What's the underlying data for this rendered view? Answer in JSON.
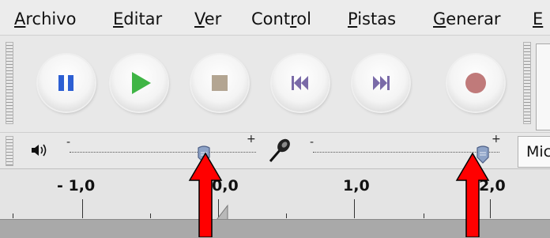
{
  "menu": {
    "items": [
      {
        "accel": "A",
        "rest": "rchivo"
      },
      {
        "accel": "E",
        "rest": "ditar"
      },
      {
        "accel": "V",
        "rest": "er"
      },
      {
        "pre": "Cont",
        "accel": "r",
        "rest": "ol"
      },
      {
        "accel": "P",
        "rest": "istas"
      },
      {
        "accel": "G",
        "rest": "enerar"
      },
      {
        "accel": "E",
        "rest": ""
      }
    ]
  },
  "transport": {
    "buttons": [
      {
        "name": "pause",
        "icon": "pause-icon",
        "color": "#2d5fd3"
      },
      {
        "name": "play",
        "icon": "play-icon",
        "color": "#3fb545"
      },
      {
        "name": "stop",
        "icon": "stop-icon",
        "color": "#b3a592"
      },
      {
        "name": "skip-to-start",
        "icon": "skip-start-icon",
        "color": "#7a6aa8"
      },
      {
        "name": "skip-to-end",
        "icon": "skip-end-icon",
        "color": "#7a6aa8"
      },
      {
        "name": "record",
        "icon": "record-icon",
        "color": "#c07a7a"
      }
    ]
  },
  "meters": {
    "playback": {
      "icon": "speaker-icon",
      "minus": "-",
      "plus": "+",
      "level": 0.72
    },
    "recording": {
      "icon": "microphone-icon",
      "minus": "-",
      "plus": "+",
      "level": 0.91
    },
    "input_label": "Mic"
  },
  "ruler": {
    "labels": [
      "- 1,0",
      "0,0",
      "1,0",
      "2,0"
    ]
  },
  "annotations": {
    "arrow_color": "#ff0000"
  }
}
